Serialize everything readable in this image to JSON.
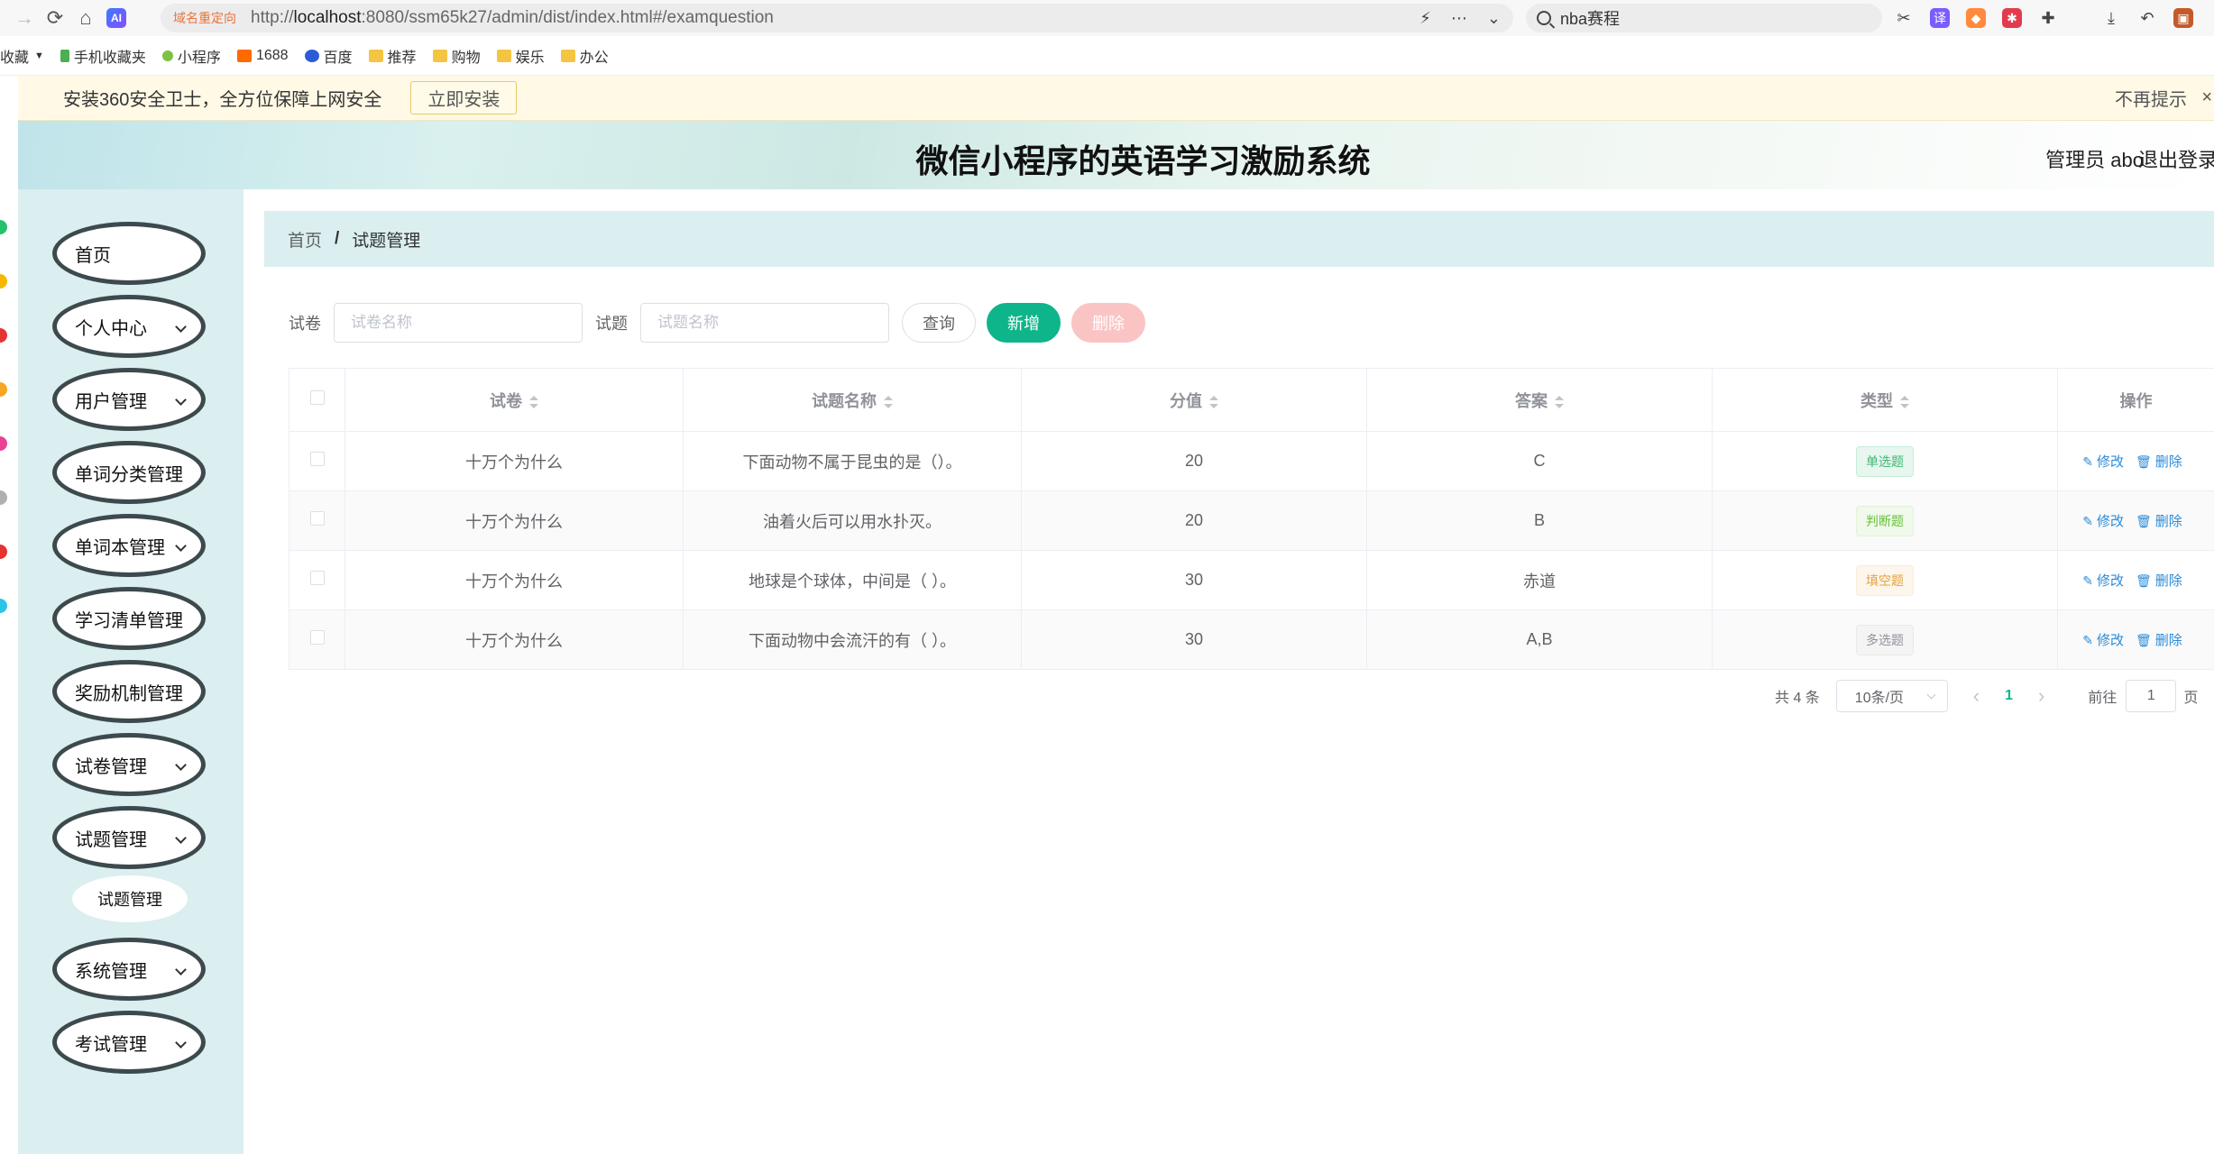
{
  "browser": {
    "redirect_tag": "域名重定向",
    "url_prefix": "http://",
    "url_host": "localhost",
    "url_rest": ":8080/ssm65k27/admin/dist/index.html#/examquestion",
    "search_text": "nba赛程",
    "ai_badge": "AI"
  },
  "bookmarks": {
    "collect": "收藏",
    "items": [
      "手机收藏夹",
      "小程序",
      "1688",
      "百度",
      "推荐",
      "购物",
      "娱乐",
      "办公"
    ]
  },
  "notice": {
    "text": "安装360安全卫士，全方位保障上网安全",
    "install": "立即安装",
    "dismiss": "不再提示"
  },
  "header": {
    "title": "微信小程序的英语学习激励系统",
    "user": "管理员 abo",
    "logout": "退出登录"
  },
  "sidebar": {
    "items": [
      {
        "label": "首页"
      },
      {
        "label": "个人中心"
      },
      {
        "label": "用户管理"
      },
      {
        "label": "单词分类管理"
      },
      {
        "label": "单词本管理"
      },
      {
        "label": "学习清单管理"
      },
      {
        "label": "奖励机制管理"
      },
      {
        "label": "试卷管理"
      },
      {
        "label": "试题管理"
      },
      {
        "label": "系统管理"
      },
      {
        "label": "考试管理"
      }
    ],
    "sub_item": "试题管理"
  },
  "breadcrumb": {
    "home": "首页",
    "sep": "/",
    "current": "试题管理"
  },
  "filters": {
    "paper_label": "试卷",
    "paper_placeholder": "试卷名称",
    "question_label": "试题",
    "question_placeholder": "试题名称",
    "query": "查询",
    "add": "新增",
    "delete": "删除"
  },
  "table": {
    "columns": [
      "试卷",
      "试题名称",
      "分值",
      "答案",
      "类型",
      "操作"
    ],
    "edit_label": "修改",
    "delete_label": "删除",
    "rows": [
      {
        "paper": "十万个为什么",
        "name": "下面动物不属于昆虫的是（）。",
        "score": "20",
        "answer": "C",
        "type": "单选题",
        "type_style": "success"
      },
      {
        "paper": "十万个为什么",
        "name": "油着火后可以用水扑灭。",
        "score": "20",
        "answer": "B",
        "type": "判断题",
        "type_style": "green"
      },
      {
        "paper": "十万个为什么",
        "name": "地球是个球体，中间是（ ）。",
        "score": "30",
        "answer": "赤道",
        "type": "填空题",
        "type_style": "warning"
      },
      {
        "paper": "十万个为什么",
        "name": "下面动物中会流汗的有（ ）。",
        "score": "30",
        "answer": "A,B",
        "type": "多选题",
        "type_style": "info"
      }
    ]
  },
  "pagination": {
    "total": "共 4 条",
    "page_size": "10条/页",
    "prev": "‹",
    "current": "1",
    "next": "›",
    "goto_label": "前往",
    "goto_value": "1",
    "goto_suffix": "页"
  }
}
